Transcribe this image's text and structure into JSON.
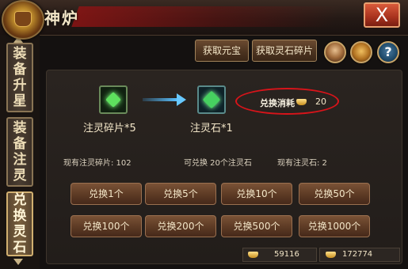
{
  "header": {
    "title": "神炉",
    "close_label": "X"
  },
  "sidebar": {
    "tabs": [
      {
        "label": [
          "装",
          "备",
          "升",
          "星"
        ],
        "active": false
      },
      {
        "label": [
          "装",
          "备",
          "注",
          "灵"
        ],
        "active": false
      },
      {
        "label": [
          "兑",
          "换",
          "灵",
          "石"
        ],
        "active": true
      }
    ]
  },
  "toolbar": {
    "get_yuanbao_label": "获取元宝",
    "get_shard_label": "获取灵石碎片",
    "help_label": "?",
    "icons": [
      "avatar-icon",
      "treasure-bowl-icon",
      "help-icon"
    ]
  },
  "exchange": {
    "input_label": "注灵碎片*5",
    "output_label": "注灵石*1",
    "cost_label": "兑换消耗",
    "cost_value": "20",
    "current_shards_label": "现有注灵碎片: 102",
    "can_exchange_label": "可兑换 20个注灵石",
    "current_stones_label": "现有注灵石: 2"
  },
  "exchange_buttons": [
    "兑换1个",
    "兑换5个",
    "兑换10个",
    "兑换50个",
    "兑换100个",
    "兑换200个",
    "兑换500个",
    "兑换1000个"
  ],
  "currency": {
    "silver": "59116",
    "gold": "172774"
  },
  "colors": {
    "accent_red": "#d8141a",
    "button_brown": "#5c3a24",
    "text_cream": "#f3e6c8"
  }
}
